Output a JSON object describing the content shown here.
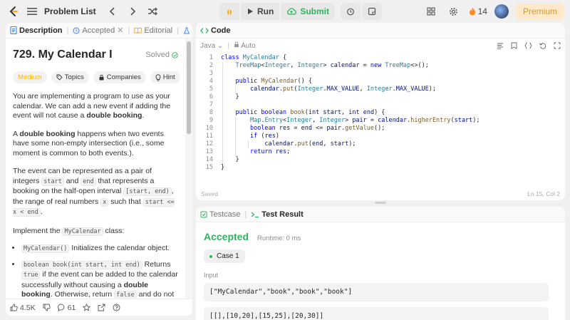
{
  "topbar": {
    "problem_list": "Problem List",
    "run_label": "Run",
    "submit_label": "Submit",
    "streak_count": "14",
    "premium_label": "Premium"
  },
  "left_tabs": {
    "description": "Description",
    "accepted": "Accepted",
    "editorial": "Editorial"
  },
  "problem": {
    "title": "729. My Calendar I",
    "status": "Solved",
    "tags": [
      "Medium",
      "Topics",
      "Companies",
      "Hint"
    ],
    "p1_a": "You are implementing a program to use as your calendar. We can add a new event if adding the event will not cause a ",
    "p1_b": "double booking",
    "p1_c": ".",
    "p2_a": "A ",
    "p2_b": "double booking",
    "p2_c": " happens when two events have some non-empty intersection (i.e., some moment is common to both events.).",
    "p3_a": "The event can be represented as a pair of integers ",
    "p3_start": "start",
    "p3_b": " and ",
    "p3_end": "end",
    "p3_c": " that represents a booking on the half-open interval ",
    "p3_interval": "[start, end)",
    "p3_d": ", the range of real numbers ",
    "p3_x": "x",
    "p3_e": " such that ",
    "p3_cond": "start <= x < end",
    "p3_f": ".",
    "p4_a": "Implement the ",
    "p4_code": "MyCalendar",
    "p4_b": " class:",
    "b1_code": "MyCalendar()",
    "b1_text": " Initializes the calendar object.",
    "b2_code": "boolean book(int start, int end)",
    "b2_a": " Returns ",
    "b2_true": "true",
    "b2_b": " if the event can be added to the calendar successfully without causing a ",
    "b2_bold": "double booking",
    "b2_c": ". Otherwise, return ",
    "b2_false": "false",
    "b2_d": " and do not add the event to the calendar."
  },
  "left_footer": {
    "likes": "4.5K",
    "comments": "61"
  },
  "code_panel": {
    "title": "Code",
    "language": "Java",
    "auto": "Auto",
    "saved": "Saved",
    "cursor": "Ln 15, Col 2",
    "line_numbers": [
      "1",
      "2",
      "3",
      "4",
      "5",
      "6",
      "7",
      "8",
      "9",
      "10",
      "11",
      "12",
      "13",
      "14",
      "15"
    ]
  },
  "result_panel": {
    "testcase_tab": "Testcase",
    "result_tab": "Test Result",
    "verdict": "Accepted",
    "runtime": "Runtime: 0 ms",
    "case_label": "Case 1",
    "input_label": "Input",
    "input_line1": "[\"MyCalendar\",\"book\",\"book\",\"book\"]",
    "input_line2": "[[],[10,20],[15,25],[20,30]]"
  },
  "colors": {
    "accent_green": "#2db55d",
    "medium_orange": "#ffb800",
    "premium_text": "#d99a2b",
    "streak_fire": "#ff8a1f"
  }
}
